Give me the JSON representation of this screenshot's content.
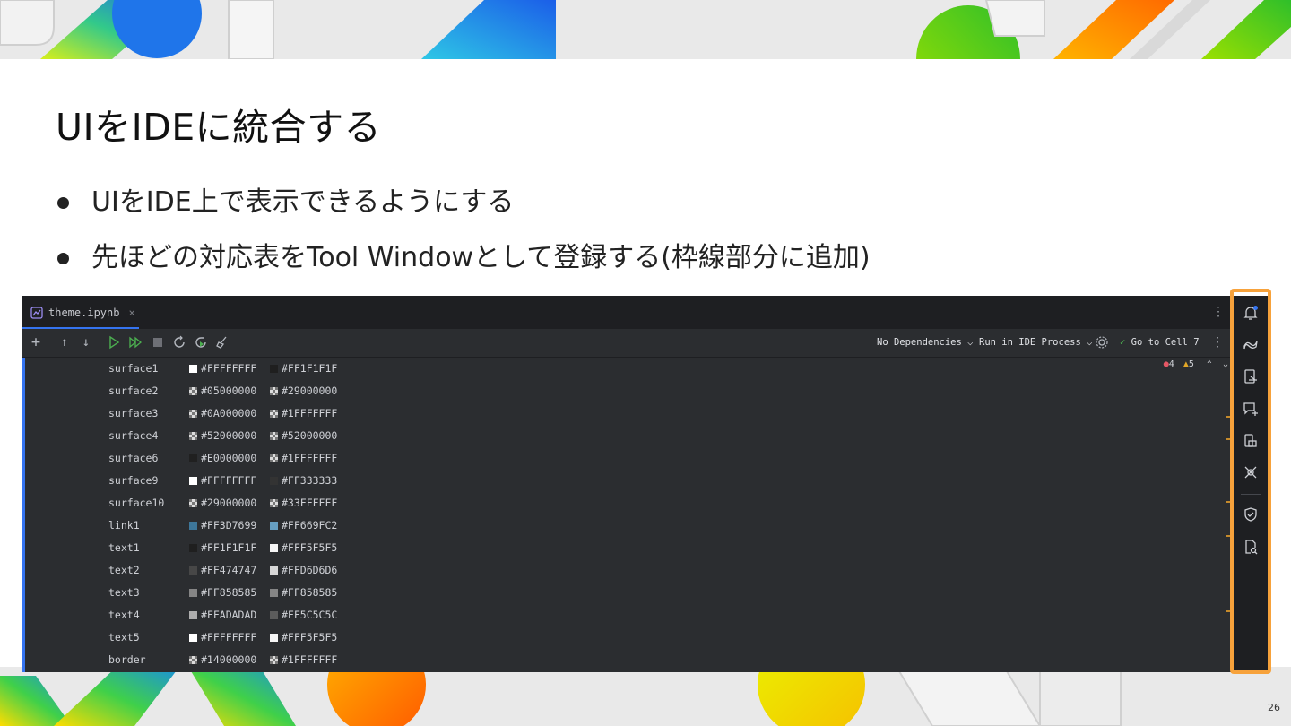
{
  "slide": {
    "title": "UIをIDEに統合する",
    "bullets": [
      "UIをIDE上で表示できるようにする",
      "先ほどの対応表をTool Windowとして登録する(枠線部分に追加)"
    ],
    "page_number": "26"
  },
  "ide": {
    "tab": {
      "label": "theme.ipynb",
      "close": "×",
      "icon": "notebook-icon"
    },
    "tabbar_menu": "⋮",
    "toolbar": {
      "dependencies_label": "No Dependencies",
      "run_mode_label": "Run in IDE Process",
      "go_to_cell_label": "Go to Cell 7",
      "menu": "⋮",
      "icons": [
        "add-cell-icon",
        "move-up-icon",
        "move-down-icon",
        "run-cell-icon",
        "run-all-icon",
        "stop-icon",
        "restart-icon",
        "restart-run-all-icon",
        "clear-outputs-icon",
        "settings-icon",
        "check-icon"
      ]
    },
    "inspection": {
      "errors": "4",
      "warnings": "5"
    },
    "rows": [
      {
        "name": "surface1",
        "v1": "#FFFFFFFF",
        "c1": "#ffffff",
        "v2": "#FF1F1F1F",
        "c2": "#1f1f1f"
      },
      {
        "name": "surface2",
        "v1": "#05000000",
        "c1": "checker",
        "v2": "#29000000",
        "c2": "checker"
      },
      {
        "name": "surface3",
        "v1": "#0A000000",
        "c1": "checker",
        "v2": "#1FFFFFFF",
        "c2": "checker"
      },
      {
        "name": "surface4",
        "v1": "#52000000",
        "c1": "checker",
        "v2": "#52000000",
        "c2": "checker"
      },
      {
        "name": "surface6",
        "v1": "#E0000000",
        "c1": "#202020",
        "v2": "#1FFFFFFF",
        "c2": "checker"
      },
      {
        "name": "surface9",
        "v1": "#FFFFFFFF",
        "c1": "#ffffff",
        "v2": "#FF333333",
        "c2": "#333333"
      },
      {
        "name": "surface10",
        "v1": "#29000000",
        "c1": "checker",
        "v2": "#33FFFFFF",
        "c2": "checker"
      },
      {
        "name": "link1",
        "v1": "#FF3D7699",
        "c1": "#3d7699",
        "v2": "#FF669FC2",
        "c2": "#669fc2"
      },
      {
        "name": "text1",
        "v1": "#FF1F1F1F",
        "c1": "#1f1f1f",
        "v2": "#FFF5F5F5",
        "c2": "#f5f5f5"
      },
      {
        "name": "text2",
        "v1": "#FF474747",
        "c1": "#474747",
        "v2": "#FFD6D6D6",
        "c2": "#d6d6d6"
      },
      {
        "name": "text3",
        "v1": "#FF858585",
        "c1": "#858585",
        "v2": "#FF858585",
        "c2": "#858585"
      },
      {
        "name": "text4",
        "v1": "#FFADADAD",
        "c1": "#adadad",
        "v2": "#FF5C5C5C",
        "c2": "#5c5c5c"
      },
      {
        "name": "text5",
        "v1": "#FFFFFFFF",
        "c1": "#ffffff",
        "v2": "#FFF5F5F5",
        "c2": "#f5f5f5"
      },
      {
        "name": "border",
        "v1": "#14000000",
        "c1": "checker",
        "v2": "#1FFFFFFF",
        "c2": "checker"
      }
    ],
    "tool_window_icons": [
      "notifications-icon",
      "ai-assistant-icon",
      "database-icon",
      "chat-add-icon",
      "clipboard-icon",
      "plugin-icon",
      "shield-check-icon",
      "search-file-icon"
    ]
  },
  "colors": {
    "accent_blue": "#3574f0",
    "highlight_orange": "#f7a23b",
    "ide_background": "#2b2d30",
    "ide_dark": "#1e1f22"
  }
}
